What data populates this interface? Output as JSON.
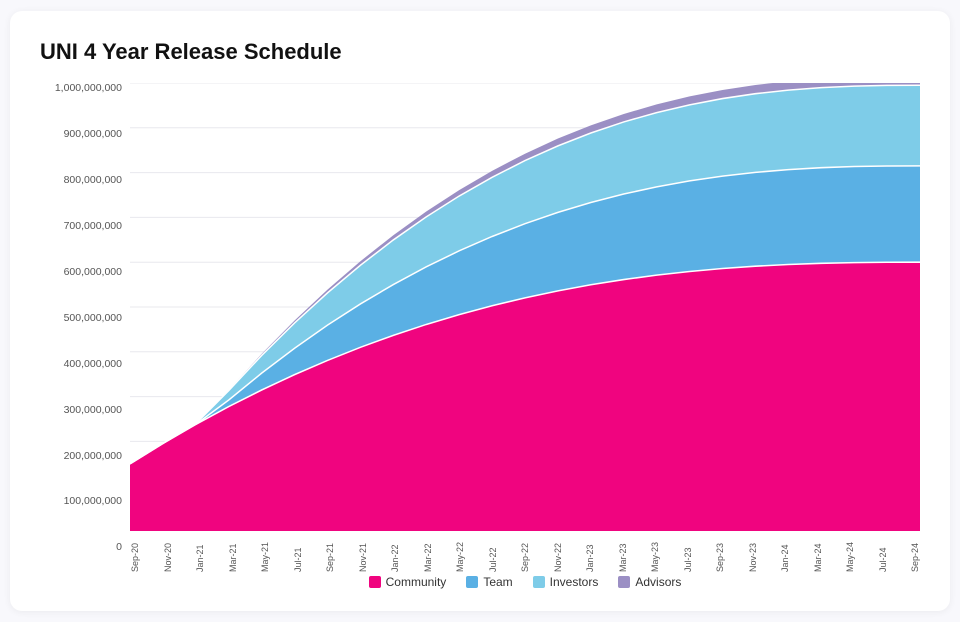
{
  "title": "UNI 4 Year Release Schedule",
  "yAxis": {
    "labels": [
      "1,000,000,000",
      "900,000,000",
      "800,000,000",
      "700,000,000",
      "600,000,000",
      "500,000,000",
      "400,000,000",
      "300,000,000",
      "200,000,000",
      "100,000,000",
      "0"
    ]
  },
  "xAxis": {
    "labels": [
      "Sep-20",
      "Nov-20",
      "Jan-21",
      "Mar-21",
      "May-21",
      "Jul-21",
      "Sep-21",
      "Nov-21",
      "Jan-22",
      "Mar-22",
      "May-22",
      "Jul-22",
      "Sep-22",
      "Nov-22",
      "Jan-23",
      "Mar-23",
      "May-23",
      "Jul-23",
      "Sep-23",
      "Nov-23",
      "Jan-24",
      "Mar-24",
      "May-24",
      "Jul-24",
      "Sep-24"
    ]
  },
  "legend": [
    {
      "label": "Community",
      "color": "#F0047F"
    },
    {
      "label": "Team",
      "color": "#5AB0E4"
    },
    {
      "label": "Investors",
      "color": "#7ECCE8"
    },
    {
      "label": "Advisors",
      "color": "#9B8FC4"
    }
  ],
  "colors": {
    "community": "#F0047F",
    "team": "#5AB0E4",
    "investors": "#7ECCE8",
    "advisors": "#9B8FC4",
    "background": "#ffffff"
  }
}
